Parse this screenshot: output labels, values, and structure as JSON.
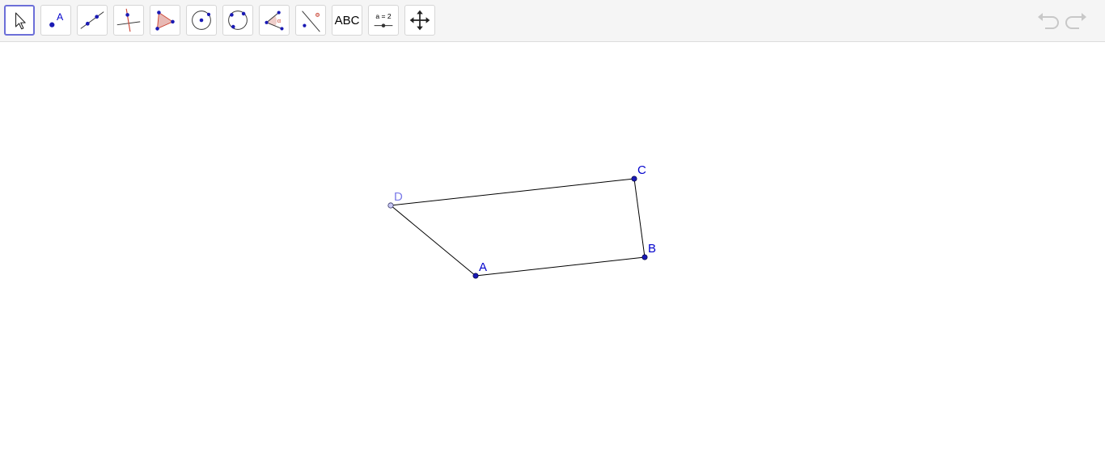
{
  "toolbar": {
    "tools": [
      {
        "name": "move-tool",
        "icon": "cursor-arrow-icon"
      },
      {
        "name": "point-tool",
        "icon": "point-icon",
        "text": "A"
      },
      {
        "name": "line-tool",
        "icon": "line-through-two-points-icon"
      },
      {
        "name": "perpendicular-line-tool",
        "icon": "perpendicular-line-icon"
      },
      {
        "name": "polygon-tool",
        "icon": "polygon-icon"
      },
      {
        "name": "circle-tool",
        "icon": "circle-center-point-icon"
      },
      {
        "name": "circle-three-points-tool",
        "icon": "circle-three-points-icon"
      },
      {
        "name": "angle-tool",
        "icon": "angle-icon",
        "text": "α"
      },
      {
        "name": "reflect-tool",
        "icon": "reflect-about-line-icon"
      },
      {
        "name": "text-tool",
        "icon": "text-icon",
        "text": "ABC"
      },
      {
        "name": "slider-tool",
        "icon": "slider-icon",
        "text": "a = 2"
      },
      {
        "name": "move-graphics-view-tool",
        "icon": "move-graphics-view-icon"
      }
    ],
    "undo_icon": "undo-icon",
    "redo_icon": "redo-icon"
  },
  "geometry": {
    "points": [
      {
        "label": "A",
        "color": "#0000cc",
        "style": "solid"
      },
      {
        "label": "B",
        "color": "#0000cc",
        "style": "solid"
      },
      {
        "label": "C",
        "color": "#0000cc",
        "style": "solid"
      },
      {
        "label": "D",
        "color": "#7b7be8",
        "style": "faded"
      }
    ],
    "segments": [
      "AB",
      "BC",
      "CD",
      "DA"
    ],
    "colors": {
      "segment": "#000000",
      "point_fill": "#1a1ab4",
      "active_border": "#6c6fd8",
      "icon_red": "#cc4433",
      "polygon_fill": "#e8b9b4"
    }
  }
}
